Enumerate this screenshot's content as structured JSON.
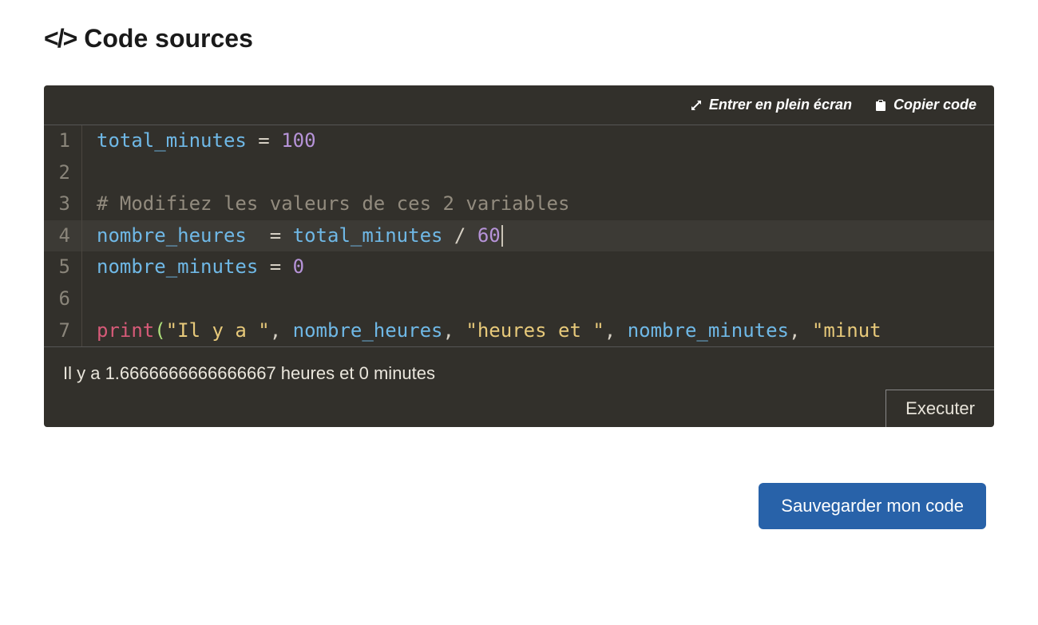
{
  "header": {
    "title": "Code sources"
  },
  "toolbar": {
    "fullscreen_label": "Entrer en plein écran",
    "copy_label": "Copier code"
  },
  "code": {
    "active_line": 4,
    "lines": [
      {
        "n": 1,
        "tokens": [
          {
            "cls": "tok-var",
            "t": "total_minutes"
          },
          {
            "cls": "tok-op",
            "t": " = "
          },
          {
            "cls": "tok-num",
            "t": "100"
          }
        ]
      },
      {
        "n": 2,
        "tokens": []
      },
      {
        "n": 3,
        "tokens": [
          {
            "cls": "tok-com",
            "t": "# Modifiez les valeurs de ces 2 variables"
          }
        ]
      },
      {
        "n": 4,
        "tokens": [
          {
            "cls": "tok-var",
            "t": "nombre_heures"
          },
          {
            "cls": "tok-op",
            "t": "  = "
          },
          {
            "cls": "tok-var",
            "t": "total_minutes"
          },
          {
            "cls": "tok-op",
            "t": " / "
          },
          {
            "cls": "tok-num",
            "t": "60"
          }
        ],
        "cursor_after": true
      },
      {
        "n": 5,
        "tokens": [
          {
            "cls": "tok-var",
            "t": "nombre_minutes"
          },
          {
            "cls": "tok-op",
            "t": " = "
          },
          {
            "cls": "tok-num",
            "t": "0"
          }
        ]
      },
      {
        "n": 6,
        "tokens": []
      },
      {
        "n": 7,
        "tokens": [
          {
            "cls": "tok-fn",
            "t": "print"
          },
          {
            "cls": "tok-par",
            "t": "("
          },
          {
            "cls": "tok-str",
            "t": "\"Il y a \""
          },
          {
            "cls": "tok-op",
            "t": ", "
          },
          {
            "cls": "tok-var",
            "t": "nombre_heures"
          },
          {
            "cls": "tok-op",
            "t": ", "
          },
          {
            "cls": "tok-str",
            "t": "\"heures et \""
          },
          {
            "cls": "tok-op",
            "t": ", "
          },
          {
            "cls": "tok-var",
            "t": "nombre_minutes"
          },
          {
            "cls": "tok-op",
            "t": ", "
          },
          {
            "cls": "tok-str",
            "t": "\"minut"
          }
        ]
      }
    ]
  },
  "output": {
    "text": "Il y a  1.6666666666666667 heures et  0 minutes"
  },
  "buttons": {
    "execute": "Executer",
    "save": "Sauvegarder mon code"
  }
}
